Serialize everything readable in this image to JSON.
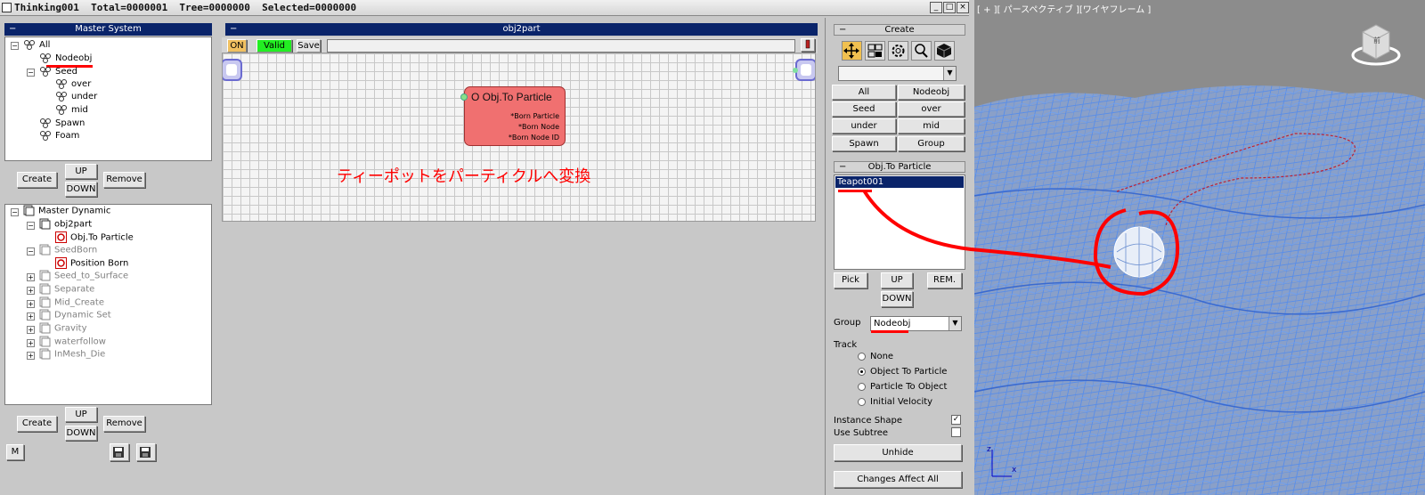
{
  "window": {
    "title": "Thinking001  Total=0000001  Tree=0000000  Selected=0000000",
    "minimize": "_",
    "maximize": "□",
    "close": "×"
  },
  "master_system": {
    "header": "Master System",
    "items": [
      {
        "label": "All"
      },
      {
        "label": "Nodeobj"
      },
      {
        "label": "Seed"
      },
      {
        "label": "over"
      },
      {
        "label": "under"
      },
      {
        "label": "mid"
      },
      {
        "label": "Spawn"
      },
      {
        "label": "Foam"
      }
    ],
    "buttons": {
      "create": "Create",
      "up": "UP",
      "down": "DOWN",
      "remove": "Remove"
    }
  },
  "master_dynamic": {
    "items": [
      {
        "label": "Master Dynamic"
      },
      {
        "label": "obj2part"
      },
      {
        "label": "Obj.To Particle"
      },
      {
        "label": "SeedBorn"
      },
      {
        "label": "Position Born"
      },
      {
        "label": "Seed_to_Surface"
      },
      {
        "label": "Separate"
      },
      {
        "label": "Mid_Create"
      },
      {
        "label": "Dynamic Set"
      },
      {
        "label": "Gravity"
      },
      {
        "label": "waterfollow"
      },
      {
        "label": "InMesh_Die"
      }
    ],
    "buttons": {
      "create": "Create",
      "up": "UP",
      "down": "DOWN",
      "remove": "Remove",
      "m": "M"
    }
  },
  "graph": {
    "header": "obj2part",
    "on": "ON",
    "valid": "Valid",
    "save": "Save",
    "node": {
      "title": "O Obj.To Particle",
      "outputs": [
        "*Born Particle",
        "*Born Node",
        "*Born Node ID"
      ]
    },
    "annotation": "ティーポットをパーティクルへ変換"
  },
  "create_panel": {
    "header": "Create",
    "groups": [
      "All",
      "Nodeobj",
      "Seed",
      "over",
      "under",
      "mid",
      "Spawn",
      "Group"
    ]
  },
  "obj_to_particle": {
    "header": "Obj.To Particle",
    "list": [
      "Teapot001"
    ],
    "buttons": {
      "pick": "Pick",
      "up": "UP",
      "rem": "REM.",
      "down": "DOWN"
    },
    "group_label": "Group",
    "group_value": "Nodeobj",
    "track_label": "Track",
    "track_options": [
      "None",
      "Object To Particle",
      "Particle To Object",
      "Initial Velocity"
    ],
    "track_selected": 1,
    "instance_shape": "Instance Shape",
    "use_subtree": "Use Subtree",
    "unhide": "Unhide",
    "changes_affect_all": "Changes Affect All"
  },
  "viewport": {
    "label": "[ + ][ パースペクティブ ][ワイヤフレーム ]",
    "viewcube": "前"
  },
  "colors": {
    "title_blue": "#0a246a",
    "node_red": "#f07070",
    "valid_green": "#22ee22",
    "on_yellow": "#f0c060",
    "annotation_red": "#ff0000",
    "mesh_blue": "#4a7fd8"
  }
}
